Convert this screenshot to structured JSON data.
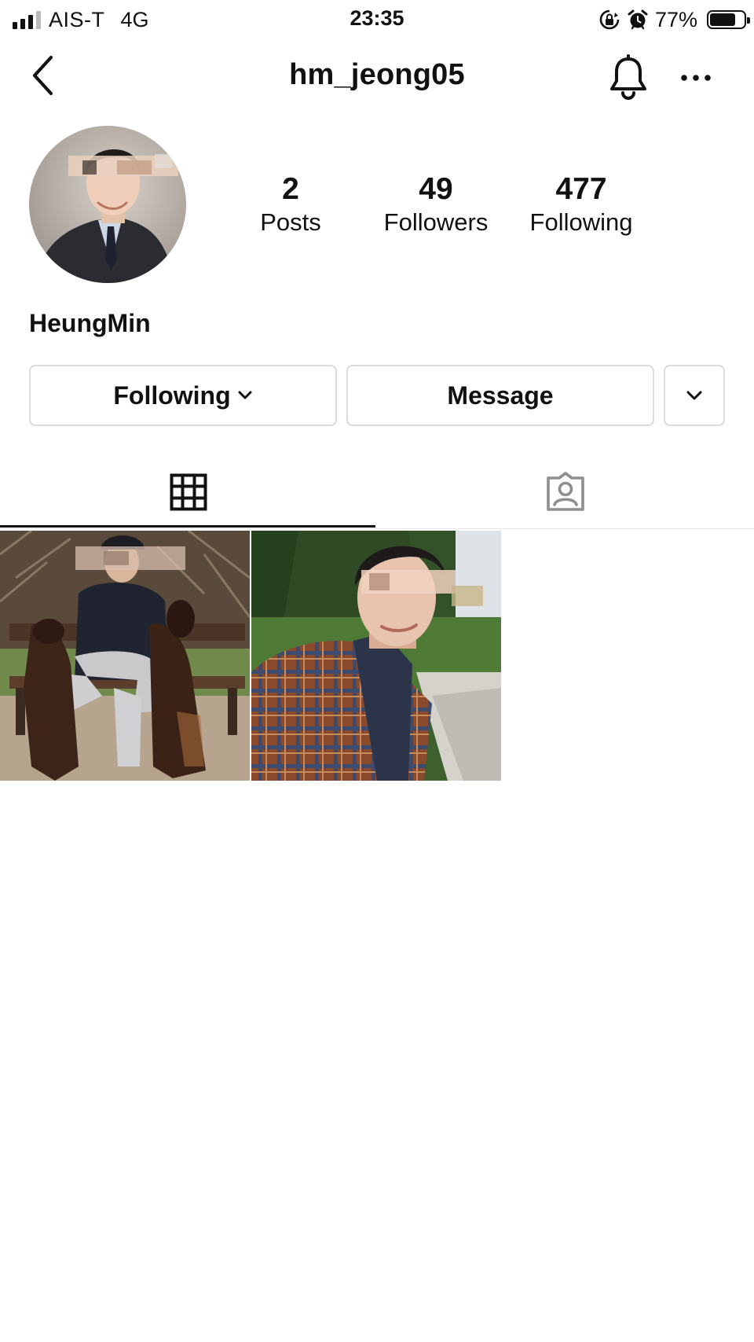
{
  "status_bar": {
    "carrier": "AIS-T",
    "network": "4G",
    "time": "23:35",
    "battery_percent": "77%",
    "battery_level": 0.77,
    "icons": [
      "signal-icon",
      "rotation-lock-icon",
      "alarm-icon",
      "battery-icon"
    ]
  },
  "header": {
    "username": "hm_jeong05",
    "icons": [
      "back-chevron-icon",
      "bell-icon",
      "more-icon"
    ]
  },
  "profile": {
    "stats": [
      {
        "value": "2",
        "label": "Posts"
      },
      {
        "value": "49",
        "label": "Followers"
      },
      {
        "value": "477",
        "label": "Following"
      }
    ],
    "display_name": "HeungMin"
  },
  "actions": {
    "following_label": "Following",
    "message_label": "Message"
  },
  "tabs": {
    "items": [
      "grid-icon",
      "tagged-icon"
    ],
    "active": 0
  },
  "posts": [
    {
      "name": "post-man-with-dobermans"
    },
    {
      "name": "post-man-in-plaid-jacket"
    }
  ],
  "colors": {
    "text": "#111111",
    "border": "#dbdbdb",
    "inactive_icon": "#8e8e8e"
  }
}
